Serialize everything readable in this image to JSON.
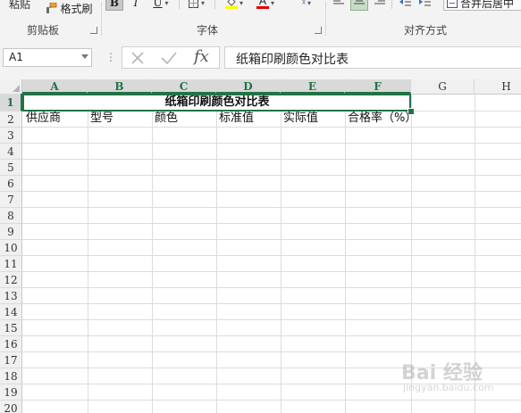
{
  "ribbon": {
    "clipboard": {
      "paste_label": "粘贴",
      "format_painter_label": "格式刷",
      "group_label": "剪贴板"
    },
    "font": {
      "bold_label": "B",
      "italic_label": "I",
      "underline_label": "U",
      "font_color_label": "A",
      "group_label": "字体"
    },
    "alignment": {
      "merge_center_label": "合并后居中",
      "group_label": "对齐方式"
    }
  },
  "formula_bar": {
    "name_box": "A1",
    "content": "纸箱印刷颜色对比表",
    "fx_label": "fx"
  },
  "sheet": {
    "columns": [
      "A",
      "B",
      "C",
      "D",
      "E",
      "F",
      "G",
      "H"
    ],
    "rows": [
      "1",
      "2",
      "3",
      "4",
      "5",
      "6",
      "7",
      "8",
      "9",
      "10",
      "11",
      "12",
      "13",
      "14",
      "15",
      "16",
      "17",
      "18",
      "19",
      "20"
    ],
    "selected_cell": "A1",
    "title": "纸箱印刷颜色对比表",
    "headers": [
      "供应商",
      "型号",
      "颜色",
      "标准值",
      "实际值",
      "合格率（%）"
    ]
  },
  "watermark": {
    "text": "Bai 经验",
    "sub": "jingyan.baidu.com"
  },
  "colors": {
    "accent": "#217346",
    "ribbon_bg": "#f3f3f3",
    "header_bg": "#f0f0f0",
    "grid_line": "#dcdcdc"
  }
}
